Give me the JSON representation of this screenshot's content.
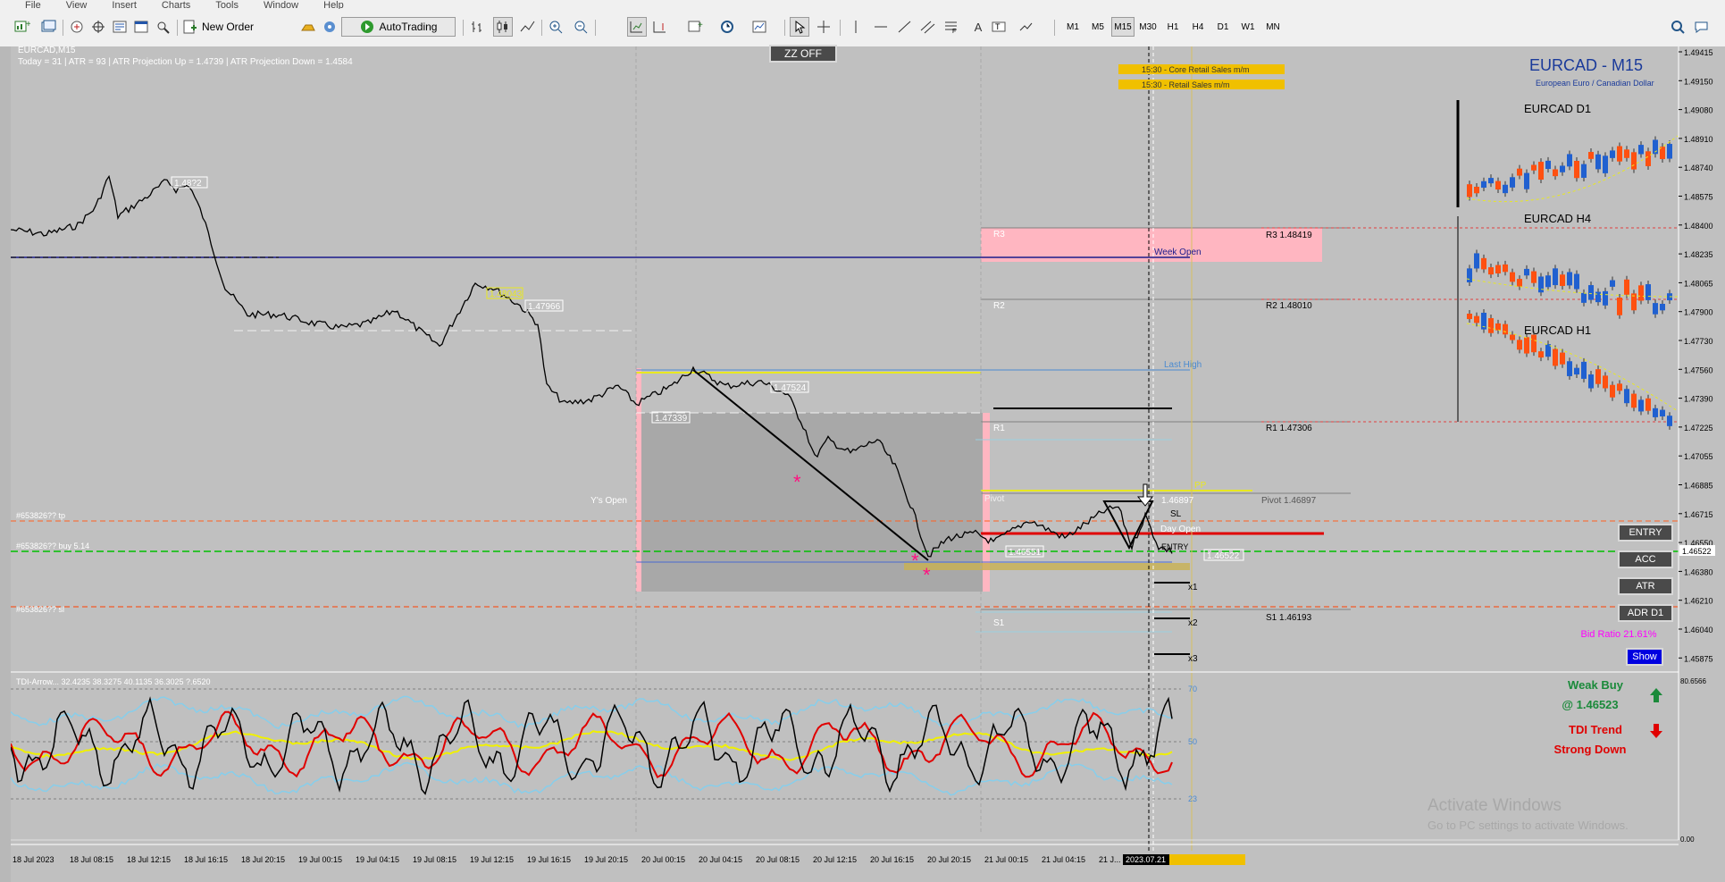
{
  "menu": [
    "File",
    "View",
    "Insert",
    "Charts",
    "Tools",
    "Window",
    "Help"
  ],
  "toolbar": {
    "new_order_label": "New Order",
    "autotrading_label": "AutoTrading",
    "timeframes": [
      "M1",
      "M5",
      "M15",
      "M30",
      "H1",
      "H4",
      "D1",
      "W1",
      "MN"
    ],
    "active_timeframe": "M15"
  },
  "chart": {
    "symbol_header": "EURCAD,M15",
    "info_line": "Today = 31   |   ATR = 93   |   ATR Projection Up = 1.4739   |   ATR Projection Down = 1.4584",
    "zz_button": "ZZ OFF",
    "title": "EURCAD - M15",
    "subtitle": "European Euro / Canadian Dollar",
    "news": [
      "15:30 - Core Retail Sales m/m",
      "15:30 - Retail Sales m/m"
    ],
    "labels": {
      "d1": "EURCAD D1",
      "h4": "EURCAD H4",
      "h1": "EURCAD H1",
      "week_open": "Week Open",
      "last_high": "Last High",
      "pp": "PP",
      "pivot_left": "Pivot",
      "r3": "R3 1.48419",
      "r2": "R2 1.48010",
      "r1": "R1 1.47306",
      "pivot": "Pivot 1.46897",
      "s1": "S1 1.46193",
      "r3_short": "R3",
      "r2_short": "R2",
      "r1_short": "R1",
      "s1_short": "S1",
      "ys_open": "Y's Open",
      "day_open": "Day Open",
      "entry_short": "ENTRY",
      "sl_short": "SL",
      "x1": "x1",
      "x2": "x2",
      "x3": "x3",
      "tp_line": "#653826?? tp",
      "buy_line": "#653826?? buy 5.14",
      "sl_line": "#653826?? sl",
      "price_hi1": "1.48?2",
      "price_hi2": "1.48043",
      "price_hi3": "1.47966",
      "price_1": "1.47524",
      "price_2": "1.47339",
      "pivot_val": "1.46897",
      "price_3": "1.46551",
      "price_4": "1.46522"
    },
    "buttons": [
      "ENTRY",
      "ACC",
      "ATR",
      "ADR D1"
    ],
    "bid_ratio": "Bid Ratio 21.61%",
    "show_button": "Show",
    "signal_1": "Weak Buy",
    "signal_1_price": "@ 1.46523",
    "signal_2": "TDI Trend",
    "signal_2b": "Strong Down",
    "watermark_1": "Activate Windows",
    "watermark_2": "Go to PC settings to activate Windows.",
    "indicator_header": "TDI-Arrow... 32.4235 38.3275 40.1135 36.3025 ?.6520",
    "indicator_levels": [
      "70",
      "50",
      "23"
    ],
    "indicator_axis": [
      "80.6566",
      "0.00"
    ],
    "price_axis": [
      "1.49415",
      "1.49150",
      "1.49080",
      "1.48910",
      "1.48740",
      "1.48575",
      "1.48400",
      "1.48235",
      "1.48065",
      "1.47900",
      "1.47730",
      "1.47560",
      "1.47390",
      "1.47225",
      "1.47055",
      "1.46885",
      "1.46715",
      "1.46550",
      "1.46380",
      "1.46210",
      "1.46040",
      "1.45875"
    ],
    "current_price": "1.46522",
    "time_axis": [
      "18 Jul 2023",
      "18 Jul 08:15",
      "18 Jul 12:15",
      "18 Jul 16:15",
      "18 Jul 20:15",
      "19 Jul 00:15",
      "19 Jul 04:15",
      "19 Jul 08:15",
      "19 Jul 12:15",
      "19 Jul 16:15",
      "19 Jul 20:15",
      "20 Jul 00:15",
      "20 Jul 04:15",
      "20 Jul 08:15",
      "20 Jul 12:15",
      "20 Jul 16:15",
      "20 Jul 20:15",
      "21 Jul 00:15",
      "21 Jul 04:15",
      "21 J..."
    ],
    "cursor_date": "2023.07.21"
  },
  "colors": {
    "bg": "#c0c0c0",
    "buy": "#00b000",
    "sell": "#ff4000",
    "pink": "#ffb6c1",
    "news": "#f0c000"
  }
}
